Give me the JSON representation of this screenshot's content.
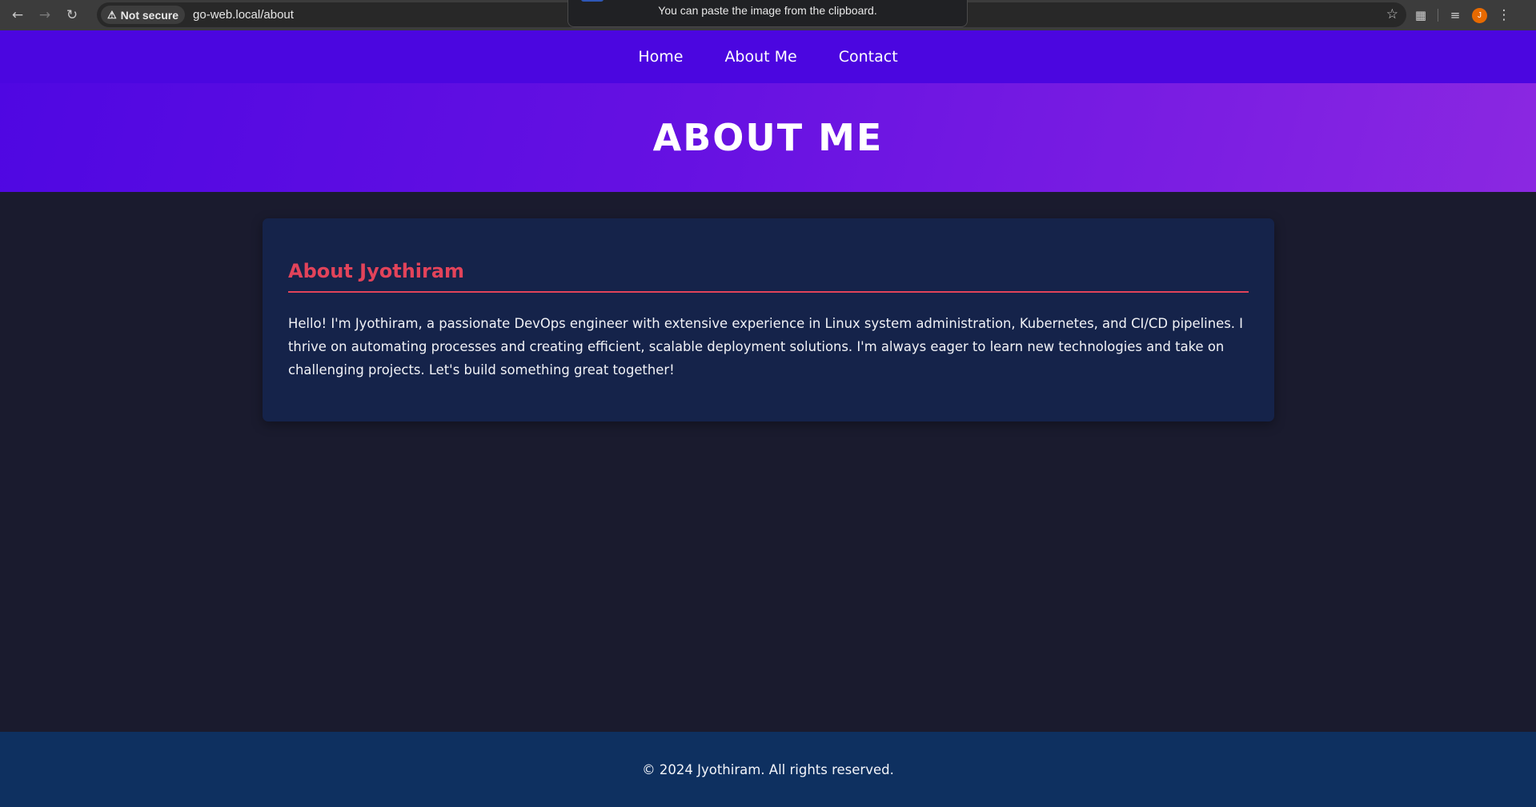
{
  "browser": {
    "security_chip": "Not secure",
    "url": "go-web.local/about",
    "toast": "You can paste the image from the clipboard.",
    "profile_initial": "J"
  },
  "nav": {
    "items": [
      {
        "label": "Home"
      },
      {
        "label": "About Me"
      },
      {
        "label": "Contact"
      }
    ]
  },
  "hero": {
    "title": "ABOUT ME"
  },
  "about": {
    "heading": "About Jyothiram",
    "body": "Hello! I'm Jyothiram, a passionate DevOps engineer with extensive experience in Linux system administration, Kubernetes, and CI/CD pipelines. I thrive on automating processes and creating efficient, scalable deployment solutions. I'm always eager to learn new technologies and take on challenging projects. Let's build something great together!"
  },
  "footer": {
    "text": "© 2024 Jyothiram. All rights reserved."
  },
  "colors": {
    "nav_bg": "#4b06e0",
    "hero_gradient_start": "#4f07e2",
    "hero_gradient_end": "#8b28e1",
    "page_bg": "#1a1b2e",
    "card_bg": "#15234a",
    "accent": "#e2435a",
    "footer_bg": "#0e3060"
  },
  "icons": [
    "back-arrow-icon",
    "forward-arrow-icon",
    "reload-icon",
    "warning-icon",
    "star-icon",
    "extensions-icon",
    "media-control-icon",
    "more-menu-icon"
  ]
}
